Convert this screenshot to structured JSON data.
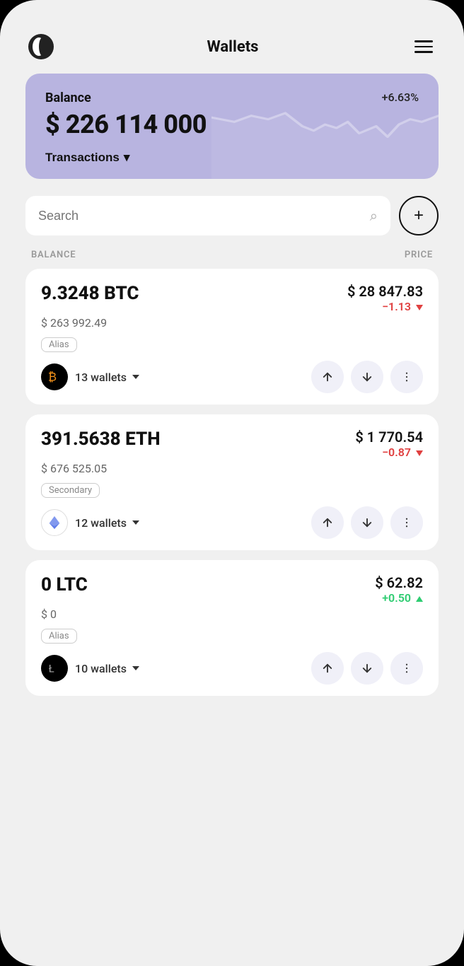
{
  "header": {
    "title": "Wallets",
    "menu_label": "menu"
  },
  "balance_card": {
    "label": "Balance",
    "percent": "+6.63%",
    "amount": "$ 226 114 000",
    "transactions_label": "Transactions"
  },
  "search": {
    "placeholder": "Search",
    "add_label": "+"
  },
  "table": {
    "col_balance": "BALANCE",
    "col_price": "PRICE"
  },
  "assets": [
    {
      "amount": "9.3248 BTC",
      "usd_value": "$ 263 992.49",
      "alias": "Alias",
      "price": "$ 28 847.83",
      "change": "−1.13",
      "change_type": "negative",
      "wallets": "13 wallets",
      "coin_type": "btc",
      "coin_symbol": "₿"
    },
    {
      "amount": "391.5638 ETH",
      "usd_value": "$ 676 525.05",
      "alias": "Secondary",
      "price": "$ 1 770.54",
      "change": "−0.87",
      "change_type": "negative",
      "wallets": "12 wallets",
      "coin_type": "eth",
      "coin_symbol": "⟠"
    },
    {
      "amount": "0 LTC",
      "usd_value": "$ 0",
      "alias": "Alias",
      "price": "$ 62.82",
      "change": "+0.50",
      "change_type": "positive",
      "wallets": "10 wallets",
      "coin_type": "ltc",
      "coin_symbol": "Ł"
    }
  ]
}
